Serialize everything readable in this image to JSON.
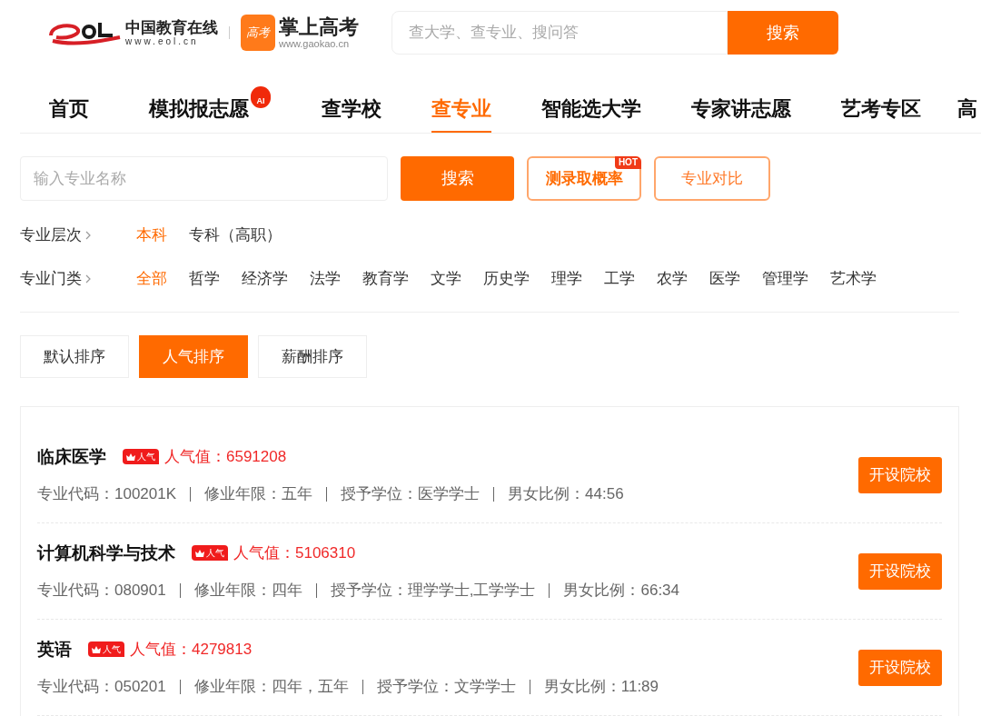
{
  "header": {
    "eol_logo": {
      "name": "中国教育在线",
      "url": "www.eol.cn"
    },
    "gaokao_logo": {
      "badge": "高考",
      "name": "掌上高考",
      "url": "www.gaokao.cn"
    },
    "search": {
      "placeholder": "查大学、查专业、搜问答",
      "button": "搜索"
    }
  },
  "nav": [
    {
      "label": "首页",
      "selected": false
    },
    {
      "label": "模拟报志愿",
      "selected": false,
      "ai_badge": "AI"
    },
    {
      "label": "查学校",
      "selected": false
    },
    {
      "label": "查专业",
      "selected": true
    },
    {
      "label": "智能选大学",
      "selected": false
    },
    {
      "label": "专家讲志愿",
      "selected": false
    },
    {
      "label": "艺考专区",
      "selected": false
    },
    {
      "label": "高",
      "selected": false
    }
  ],
  "major_search": {
    "placeholder": "输入专业名称",
    "button": "搜索",
    "probability_button": "测录取概率",
    "hot_badge": "HOT",
    "compare_button": "专业对比"
  },
  "filters": [
    {
      "label": "专业层次",
      "options": [
        {
          "label": "本科",
          "selected": true
        },
        {
          "label": "专科（高职）",
          "selected": false
        }
      ]
    },
    {
      "label": "专业门类",
      "options": [
        {
          "label": "全部",
          "selected": true
        },
        {
          "label": "哲学",
          "selected": false
        },
        {
          "label": "经济学",
          "selected": false
        },
        {
          "label": "法学",
          "selected": false
        },
        {
          "label": "教育学",
          "selected": false
        },
        {
          "label": "文学",
          "selected": false
        },
        {
          "label": "历史学",
          "selected": false
        },
        {
          "label": "理学",
          "selected": false
        },
        {
          "label": "工学",
          "selected": false
        },
        {
          "label": "农学",
          "selected": false
        },
        {
          "label": "医学",
          "selected": false
        },
        {
          "label": "管理学",
          "selected": false
        },
        {
          "label": "艺术学",
          "selected": false
        }
      ]
    }
  ],
  "sort_tabs": [
    {
      "label": "默认排序",
      "selected": false
    },
    {
      "label": "人气排序",
      "selected": true
    },
    {
      "label": "薪酬排序",
      "selected": false
    }
  ],
  "majors": [
    {
      "name": "临床医学",
      "badge": "人气",
      "popularity": "人气值：6591208",
      "meta": [
        "专业代码：100201K",
        "修业年限：五年",
        "授予学位：医学学士",
        "男女比例：44:56"
      ],
      "button": "开设院校"
    },
    {
      "name": "计算机科学与技术",
      "badge": "人气",
      "popularity": "人气值：5106310",
      "meta": [
        "专业代码：080901",
        "修业年限：四年",
        "授予学位：理学学士,工学学士",
        "男女比例：66:34"
      ],
      "button": "开设院校"
    },
    {
      "name": "英语",
      "badge": "人气",
      "popularity": "人气值：4279813",
      "meta": [
        "专业代码：050201",
        "修业年限：四年，五年",
        "授予学位：文学学士",
        "男女比例：11:89"
      ],
      "button": "开设院校"
    }
  ]
}
